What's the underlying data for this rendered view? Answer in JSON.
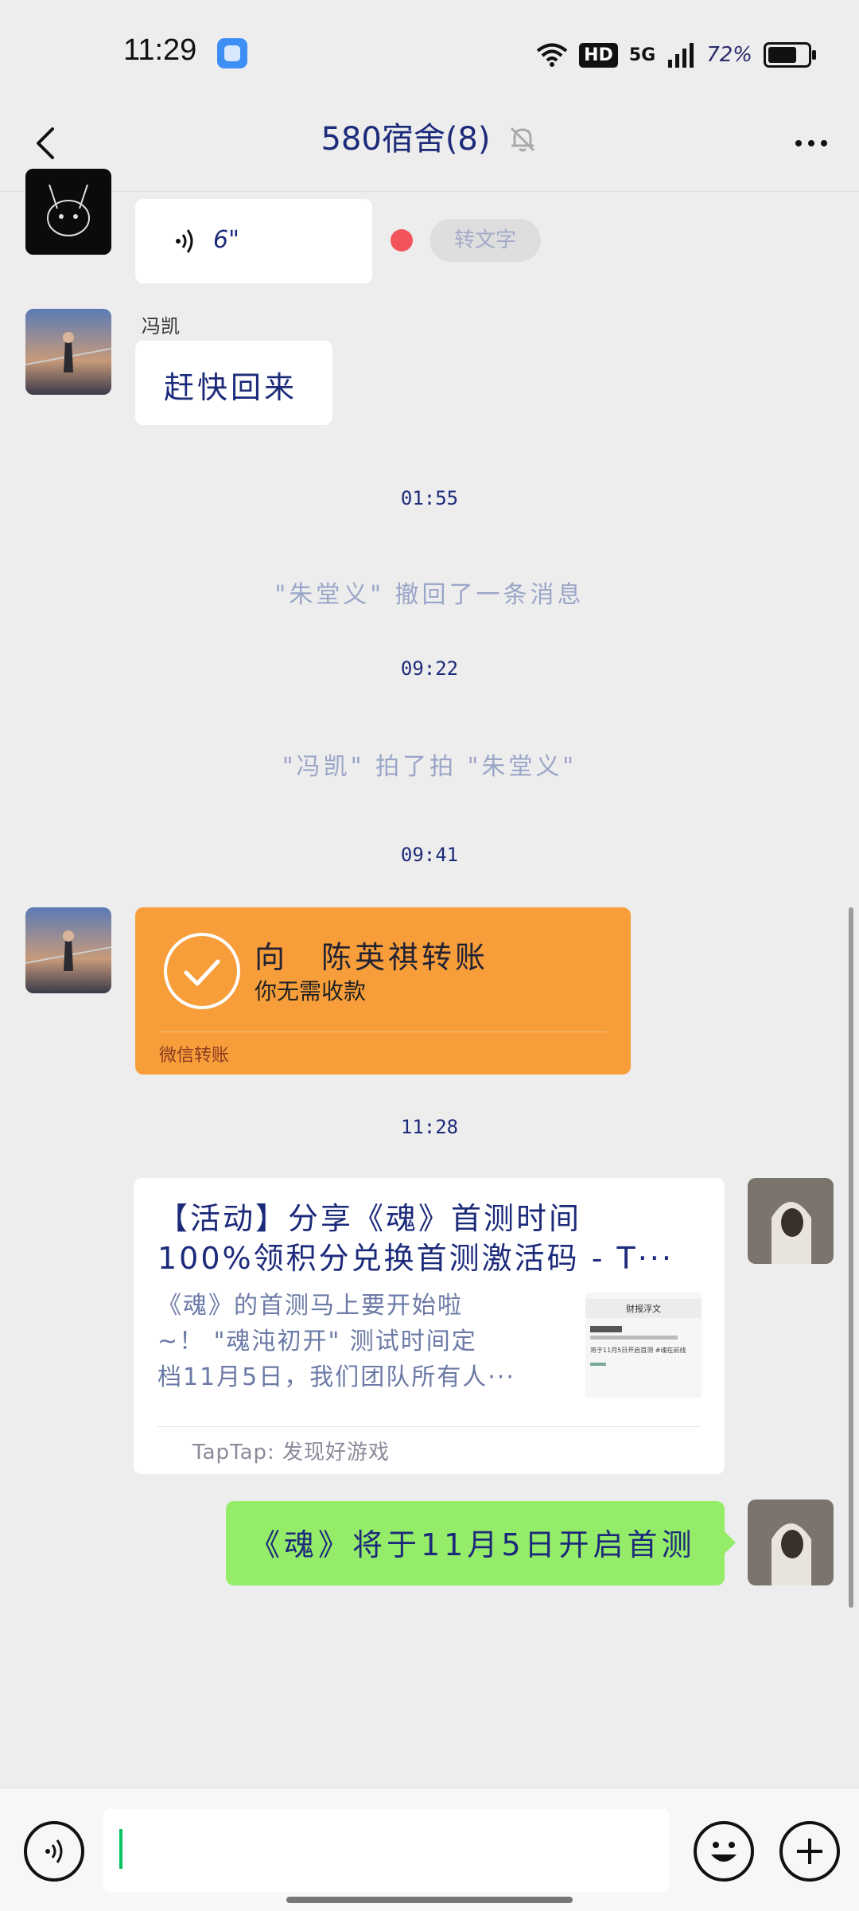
{
  "status_bar": {
    "time": "11:29",
    "network": "5G",
    "hd": "HD",
    "battery": "72%"
  },
  "nav": {
    "title": "580宿舍(8)",
    "back_icon": "chevron-left-icon",
    "mute_icon": "bell-muted-icon",
    "more_icon": "more-dots-icon"
  },
  "messages": {
    "voice": {
      "duration": "6\"",
      "to_text": "转文字"
    },
    "m1": {
      "sender": "冯凯",
      "text": "赶快回来"
    },
    "ts1": "01:55",
    "sys1": "\"朱堂义\" 撤回了一条消息",
    "ts2": "09:22",
    "sys2": "\"冯凯\" 拍了拍 \"朱堂义\"",
    "ts3": "09:41",
    "transfer": {
      "title": "向　陈英祺转账",
      "subtitle": "你无需收款",
      "footer": "微信转账"
    },
    "ts4": "11:28",
    "link": {
      "title_line1": "【活动】分享《魂》首测时间",
      "title_line2": "100%领积分兑换首测激活码 - T···",
      "desc_line1": "《魂》的首测马上要开始啦",
      "desc_line2": "~！ \"魂沌初开\" 测试时间定",
      "desc_line3": "档11月5日，我们团队所有人···",
      "thumb_title": "财报浮文",
      "thumb_line": "将于11月5日开启首测 #魂在前线",
      "source": "TapTap: 发现好游戏"
    },
    "green": {
      "text": "《魂》将于11月5日开启首测"
    }
  },
  "input": {
    "voice_icon": "voice-icon",
    "emoji_icon": "emoji-icon",
    "plus_icon": "plus-icon",
    "placeholder": ""
  },
  "colors": {
    "background": "#ededed",
    "transfer": "#f79e3a",
    "green_bubble": "#95ec69",
    "recording_dot": "#f2545b"
  }
}
